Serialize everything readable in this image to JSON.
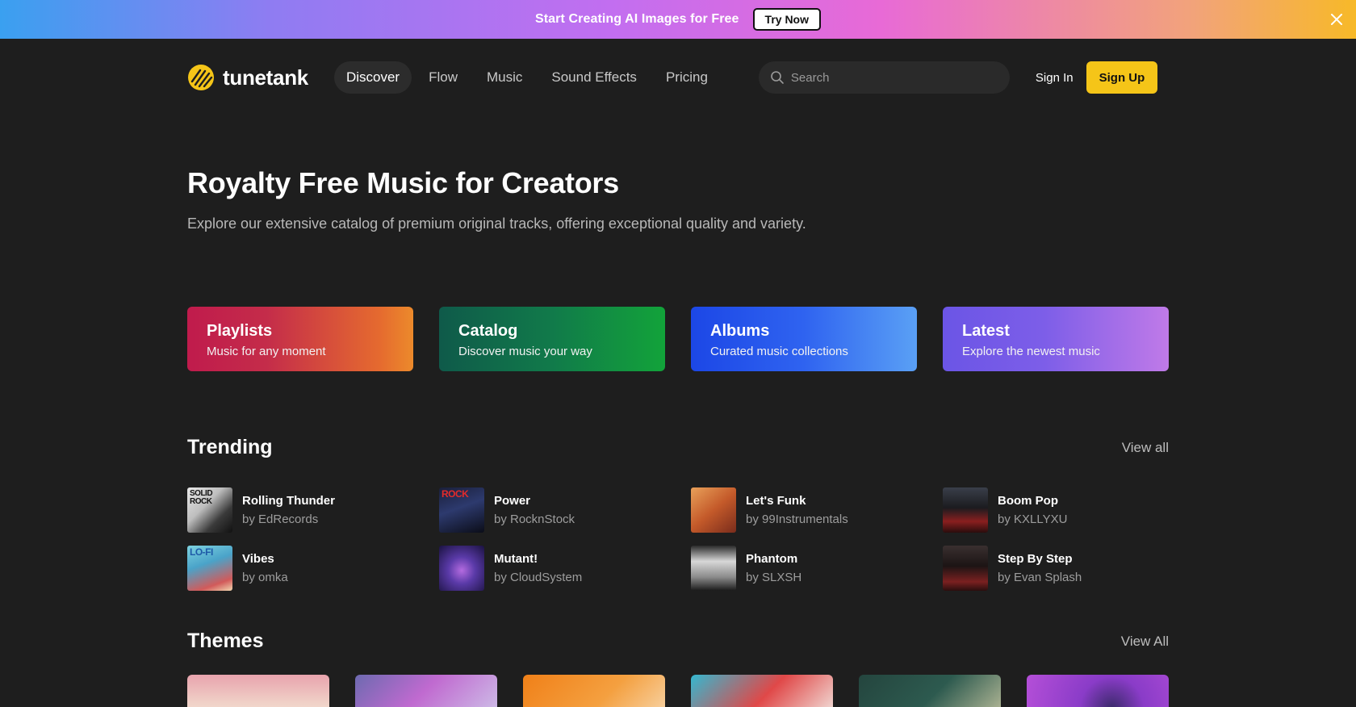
{
  "banner": {
    "text": "Start Creating AI Images for Free",
    "button": "Try Now"
  },
  "nav": {
    "brand": "tunetank",
    "links": [
      "Discover",
      "Flow",
      "Music",
      "Sound Effects",
      "Pricing"
    ],
    "active": "Discover",
    "search_placeholder": "Search",
    "sign_in": "Sign In",
    "sign_up": "Sign Up"
  },
  "hero": {
    "title": "Royalty Free Music for Creators",
    "subtitle": "Explore our extensive catalog of premium original tracks, offering exceptional quality and variety."
  },
  "categories": [
    {
      "title": "Playlists",
      "subtitle": "Music for any moment"
    },
    {
      "title": "Catalog",
      "subtitle": "Discover music your way"
    },
    {
      "title": "Albums",
      "subtitle": "Curated music collections"
    },
    {
      "title": "Latest",
      "subtitle": "Explore the newest music"
    }
  ],
  "trending": {
    "title": "Trending",
    "view_all": "View all",
    "tracks": [
      {
        "title": "Rolling Thunder",
        "artist": "by EdRecords",
        "art_text": "SOLID ROCK"
      },
      {
        "title": "Power",
        "artist": "by RocknStock",
        "art_text": "ROCK"
      },
      {
        "title": "Let's Funk",
        "artist": "by 99Instrumentals",
        "art_text": ""
      },
      {
        "title": "Boom Pop",
        "artist": "by KXLLYXU",
        "art_text": ""
      },
      {
        "title": "Vibes",
        "artist": "by omka",
        "art_text": "LO-FI"
      },
      {
        "title": "Mutant!",
        "artist": "by CloudSystem",
        "art_text": ""
      },
      {
        "title": "Phantom",
        "artist": "by SLXSH",
        "art_text": ""
      },
      {
        "title": "Step By Step",
        "artist": "by Evan Splash",
        "art_text": ""
      }
    ]
  },
  "themes": {
    "title": "Themes",
    "view_all": "View All"
  },
  "colors": {
    "accent": "#f5c518",
    "background": "#1e1e1e"
  }
}
